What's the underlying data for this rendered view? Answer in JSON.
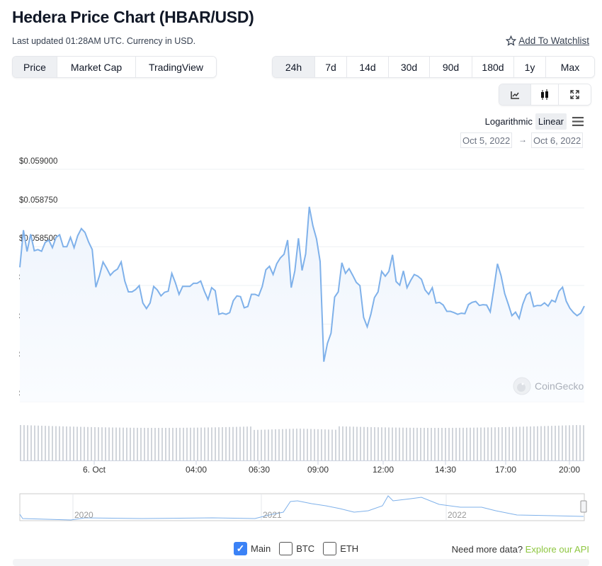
{
  "header": {
    "title": "Hedera Price Chart (HBAR/USD)",
    "subtitle": "Last updated 01:28AM UTC. Currency in USD.",
    "watchlist_label": "Add To Watchlist",
    "watchlist_icon": "star-outline-icon"
  },
  "view_tabs": [
    {
      "label": "Price",
      "active": true
    },
    {
      "label": "Market Cap",
      "active": false
    },
    {
      "label": "TradingView",
      "active": false
    }
  ],
  "range_tabs": [
    {
      "label": "24h",
      "active": true
    },
    {
      "label": "7d"
    },
    {
      "label": "14d"
    },
    {
      "label": "30d"
    },
    {
      "label": "90d"
    },
    {
      "label": "180d"
    },
    {
      "label": "1y"
    },
    {
      "label": "Max"
    }
  ],
  "chart_type_buttons": [
    {
      "icon": "line-chart-icon",
      "active": true
    },
    {
      "icon": "candlestick-icon"
    },
    {
      "icon": "fullscreen-icon"
    }
  ],
  "scale": {
    "log_label": "Logarithmic",
    "linear_label": "Linear",
    "active": "Linear",
    "menu_icon": "hamburger-menu-icon"
  },
  "date_range": {
    "from": "Oct 5, 2022",
    "to": "Oct 6, 2022",
    "arrow": "→"
  },
  "watermark": "CoinGecko",
  "colors": {
    "line": "#7fb1ea",
    "area": "#eef4fc",
    "volume": "#d1d5db",
    "api_link": "#8dc63f",
    "checkbox": "#3b82f6"
  },
  "chart_data": {
    "type": "area",
    "title": "",
    "ylim": [
      0.0575,
      0.059
    ],
    "y_ticks": [
      "$0.059000",
      "$0.058750",
      "$0.058500",
      "$0.058250",
      "$0.058000",
      "$0.057750",
      "$0.057500"
    ],
    "y_tick_values": [
      0.059,
      0.05875,
      0.0585,
      0.05825,
      0.058,
      0.05775,
      0.0575
    ],
    "x_ticks": [
      "6. Oct",
      "04:00",
      "06:30",
      "09:00",
      "12:00",
      "14:30",
      "17:00",
      "20:00"
    ],
    "grid": true,
    "values": [
      0.058367,
      0.058607,
      0.058469,
      0.058581,
      0.058474,
      0.058482,
      0.058471,
      0.058528,
      0.058543,
      0.058494,
      0.058561,
      0.058577,
      0.0585,
      0.0585,
      0.058561,
      0.058494,
      0.058571,
      0.058617,
      0.058592,
      0.058531,
      0.058482,
      0.058239,
      0.058313,
      0.058402,
      0.058362,
      0.058316,
      0.058341,
      0.058356,
      0.058402,
      0.058279,
      0.058209,
      0.058209,
      0.058224,
      0.058249,
      0.058137,
      0.058101,
      0.058137,
      0.058244,
      0.058221,
      0.058183,
      0.058206,
      0.058213,
      0.058328,
      0.058267,
      0.058193,
      0.058244,
      0.058244,
      0.058244,
      0.058264,
      0.058264,
      0.058279,
      0.058213,
      0.05816,
      0.058236,
      0.058216,
      0.058064,
      0.058071,
      0.058064,
      0.058075,
      0.058152,
      0.058183,
      0.058178,
      0.058106,
      0.058114,
      0.058193,
      0.058193,
      0.058183,
      0.058244,
      0.058351,
      0.058374,
      0.058321,
      0.05839,
      0.058428,
      0.058451,
      0.058543,
      0.058236,
      0.058344,
      0.058555,
      0.058347,
      0.058454,
      0.058758,
      0.058635,
      0.058551,
      0.058405,
      0.057758,
      0.057876,
      0.057942,
      0.058175,
      0.058209,
      0.058397,
      0.058328,
      0.058359,
      0.058316,
      0.05827,
      0.058249,
      0.058044,
      0.057983,
      0.058064,
      0.058172,
      0.058209,
      0.058341,
      0.05831,
      0.058341,
      0.058448,
      0.058275,
      0.058252,
      0.058344,
      0.058236,
      0.058282,
      0.058321,
      0.05831,
      0.05829,
      0.058221,
      0.058193,
      0.058236,
      0.058137,
      0.058141,
      0.058124,
      0.058083,
      0.058083,
      0.058075,
      0.058064,
      0.058071,
      0.058068,
      0.058126,
      0.058141,
      0.058147,
      0.058121,
      0.058126,
      0.058124,
      0.05808,
      0.058229,
      0.05839,
      0.058313,
      0.058198,
      0.058129,
      0.058055,
      0.058078,
      0.058037,
      0.058129,
      0.05819,
      0.058206,
      0.058114,
      0.058121,
      0.05812,
      0.058138,
      0.058117,
      0.058155,
      0.058144,
      0.058213,
      0.058239,
      0.058149,
      0.058103,
      0.058075,
      0.058055,
      0.058071,
      0.058117
    ]
  },
  "navigator": {
    "labels": [
      "2020",
      "2021",
      "2022"
    ]
  },
  "legend": {
    "items": [
      {
        "label": "Main",
        "checked": true
      },
      {
        "label": "BTC",
        "checked": false
      },
      {
        "label": "ETH",
        "checked": false
      }
    ]
  },
  "footer": {
    "prompt": "Need more data?",
    "link": "Explore our API"
  }
}
